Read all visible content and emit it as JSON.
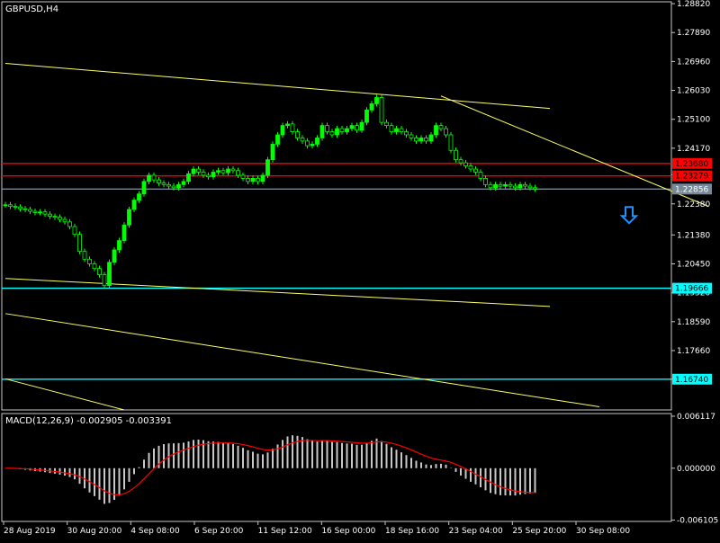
{
  "window": {
    "symbol_label": "GBPUSD,H4",
    "macd_label": "MACD(12,26,9) -0.002905 -0.003391"
  },
  "colors": {
    "background": "#000000",
    "frame": "#c8c8c8",
    "text": "#ffffff",
    "bull_candle": "#00ff00",
    "bear_candle": "#000000",
    "wick": "#00ff00",
    "trendline": "#ffff66",
    "resistance": "#ff0000",
    "support": "#00ffff",
    "current_price": "#778899",
    "macd_hist": "#c8c8c8",
    "macd_signal": "#ff0000",
    "arrow": "#1e90ff"
  },
  "chart_data": [
    {
      "type": "candlestick",
      "title": "GBPUSD,H4",
      "ylim": [
        1.1575,
        1.2888
      ],
      "y_ticks": [
        "1.28820",
        "1.27890",
        "1.26960",
        "1.26030",
        "1.25100",
        "1.24170",
        "1.23310",
        "1.22380",
        "1.21380",
        "1.20450",
        "1.19520",
        "1.18590",
        "1.17660",
        "1.16740"
      ],
      "x_ticks": [
        "28 Aug 2019",
        "30 Aug 20:00",
        "4 Sep 08:00",
        "6 Sep 20:00",
        "11 Sep 12:00",
        "16 Sep 00:00",
        "18 Sep 16:00",
        "23 Sep 04:00",
        "25 Sep 20:00",
        "30 Sep 08:00"
      ],
      "series_close_approx": [
        1.2235,
        1.223,
        1.2228,
        1.2222,
        1.222,
        1.2214,
        1.221,
        1.2212,
        1.2205,
        1.2198,
        1.2195,
        1.2188,
        1.218,
        1.2165,
        1.214,
        1.2085,
        1.206,
        1.2045,
        1.203,
        1.201,
        1.1975,
        1.205,
        1.209,
        1.212,
        1.217,
        1.222,
        1.225,
        1.227,
        1.231,
        1.233,
        1.2315,
        1.2305,
        1.23,
        1.2295,
        1.229,
        1.23,
        1.231,
        1.2335,
        1.235,
        1.234,
        1.233,
        1.2325,
        1.234,
        1.2345,
        1.2338,
        1.235,
        1.2345,
        1.233,
        1.232,
        1.231,
        1.232,
        1.231,
        1.233,
        1.238,
        1.243,
        1.246,
        1.249,
        1.2495,
        1.247,
        1.245,
        1.244,
        1.2425,
        1.243,
        1.245,
        1.249,
        1.247,
        1.246,
        1.248,
        1.247,
        1.248,
        1.249,
        1.2475,
        1.25,
        1.254,
        1.256,
        1.258,
        1.25,
        1.249,
        1.247,
        1.248,
        1.247,
        1.246,
        1.245,
        1.244,
        1.245,
        1.244,
        1.246,
        1.249,
        1.248,
        1.246,
        1.241,
        1.238,
        1.237,
        1.236,
        1.235,
        1.234,
        1.232,
        1.23,
        1.229,
        1.23,
        1.2295,
        1.23,
        1.2295,
        1.229,
        1.23,
        1.2295,
        1.229,
        1.2286
      ],
      "horizontal_levels": {
        "resistance": [
          {
            "label": "1.23680",
            "price": 1.2368
          },
          {
            "label": "1.23279",
            "price": 1.23279
          }
        ],
        "current": {
          "label": "1.22856",
          "price": 1.22856
        },
        "support": [
          {
            "label": "1.19666",
            "price": 1.19666
          },
          {
            "label": "1.16740",
            "price": 1.1674
          }
        ]
      },
      "trendlines": [
        {
          "from": {
            "bar": 0,
            "price": 1.269
          },
          "to": {
            "bar": 110,
            "price": 1.2545
          }
        },
        {
          "from": {
            "bar": 88,
            "price": 1.2585
          },
          "to": {
            "bar": 142,
            "price": 1.223
          }
        },
        {
          "from": {
            "bar": 0,
            "price": 1.1998
          },
          "to": {
            "bar": 110,
            "price": 1.1908
          }
        },
        {
          "from": {
            "bar": 0,
            "price": 1.1885
          },
          "to": {
            "bar": 120,
            "price": 1.1585
          }
        },
        {
          "from": {
            "bar": 0,
            "price": 1.1675
          },
          "to": {
            "bar": 24,
            "price": 1.1575
          }
        }
      ],
      "signal_arrow": {
        "direction": "down",
        "bar": 126,
        "price": 1.2228
      }
    },
    {
      "type": "bar",
      "title": "MACD(12,26,9) -0.002905 -0.003391",
      "ylim": [
        -0.00626,
        0.00643
      ],
      "y_ticks": [
        "0.006117",
        "0.000000",
        "-0.006105"
      ],
      "macd_value": -0.002905,
      "signal_value": -0.003391
    }
  ]
}
